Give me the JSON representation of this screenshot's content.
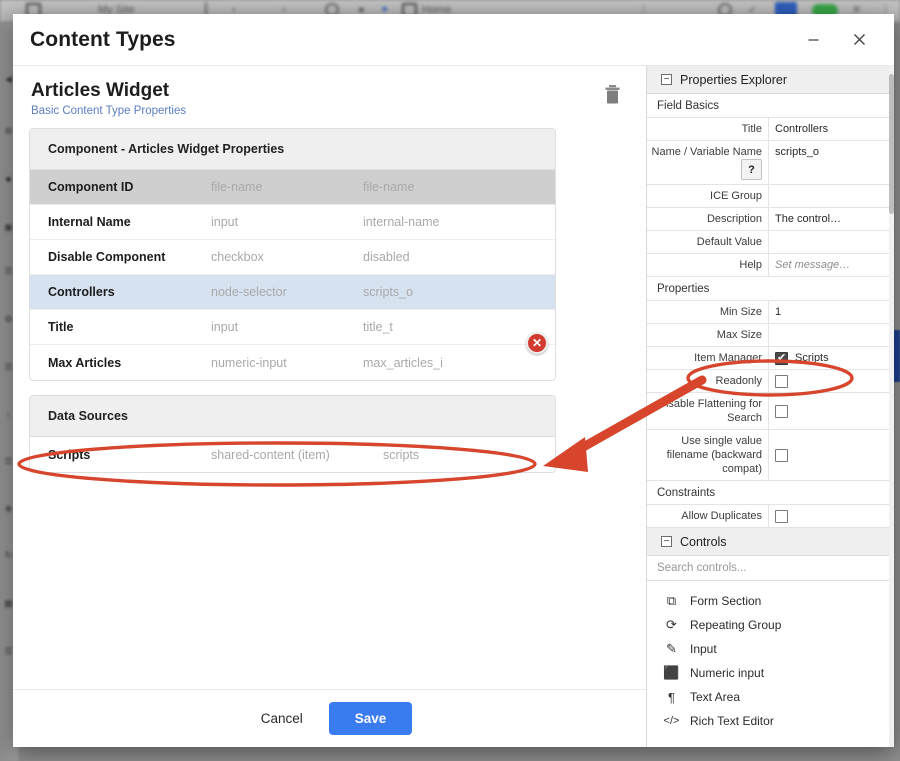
{
  "window": {
    "title": "Content Types",
    "minimize_label": "–",
    "close_label": "✕"
  },
  "content_type": {
    "name": "Articles Widget",
    "subtitle": "Basic Content Type Properties",
    "delete_icon": "trash-icon"
  },
  "properties_card": {
    "header": "Component - Articles Widget Properties",
    "rows": [
      {
        "name": "Component ID",
        "type": "file-name",
        "variable": "file-name",
        "state": "shaded"
      },
      {
        "name": "Internal Name",
        "type": "input",
        "variable": "internal-name",
        "state": "normal"
      },
      {
        "name": "Disable Component",
        "type": "checkbox",
        "variable": "disabled",
        "state": "normal"
      },
      {
        "name": "Controllers",
        "type": "node-selector",
        "variable": "scripts_o",
        "state": "selected"
      },
      {
        "name": "Title",
        "type": "input",
        "variable": "title_t",
        "state": "normal"
      },
      {
        "name": "Max Articles",
        "type": "numeric-input",
        "variable": "max_articles_i",
        "state": "normal"
      }
    ],
    "delete_field_label": "✕"
  },
  "data_sources_card": {
    "header": "Data Sources",
    "rows": [
      {
        "name": "Scripts",
        "type": "shared-content (item)",
        "variable": "scripts"
      }
    ]
  },
  "footer": {
    "cancel_label": "Cancel",
    "save_label": "Save"
  },
  "properties_explorer": {
    "title": "Properties Explorer",
    "collapse_glyph": "−",
    "field_basics": {
      "label": "Field Basics",
      "rows": [
        {
          "label": "Title",
          "value": "Controllers",
          "kind": "text"
        },
        {
          "label": "Name / Variable Name",
          "value": "scripts_o",
          "kind": "text-help",
          "help_glyph": "?"
        },
        {
          "label": "ICE Group",
          "value": "",
          "kind": "text"
        },
        {
          "label": "Description",
          "value": "The control…",
          "kind": "text"
        },
        {
          "label": "Default Value",
          "value": "",
          "kind": "text"
        },
        {
          "label": "Help",
          "value": "Set message…",
          "kind": "placeholder"
        }
      ]
    },
    "properties": {
      "label": "Properties",
      "rows": [
        {
          "label": "Min Size",
          "value": "1",
          "kind": "text"
        },
        {
          "label": "Max Size",
          "value": "",
          "kind": "text"
        },
        {
          "label": "Item Manager",
          "value": "Scripts",
          "kind": "checkbox",
          "checked": true
        },
        {
          "label": "Readonly",
          "value": "",
          "kind": "checkbox",
          "checked": false
        },
        {
          "label": "Disable Flattening for Search",
          "value": "",
          "kind": "checkbox",
          "checked": false
        },
        {
          "label": "Use single value filename (backward compat)",
          "value": "",
          "kind": "checkbox",
          "checked": false
        }
      ]
    },
    "constraints": {
      "label": "Constraints",
      "rows": [
        {
          "label": "Allow Duplicates",
          "value": "",
          "kind": "checkbox",
          "checked": false
        }
      ]
    },
    "controls": {
      "title": "Controls",
      "collapse_glyph": "−",
      "search_placeholder": "Search controls...",
      "items": [
        {
          "label": "Form Section",
          "icon": "form-section-icon",
          "glyph": "⧉"
        },
        {
          "label": "Repeating Group",
          "icon": "repeating-group-icon",
          "glyph": "⟳"
        },
        {
          "label": "Input",
          "icon": "input-icon",
          "glyph": "✎"
        },
        {
          "label": "Numeric input",
          "icon": "numeric-input-icon",
          "glyph": "⬛"
        },
        {
          "label": "Text Area",
          "icon": "text-area-icon",
          "glyph": "¶"
        },
        {
          "label": "Rich Text Editor",
          "icon": "rich-text-editor-icon",
          "glyph": "</>"
        }
      ]
    }
  },
  "annotations": {
    "color": "#d6452c",
    "highlight_item_manager": "Item Manager",
    "highlight_scripts_row": "Scripts",
    "arrow": "points from Item Manager property to the Scripts data source row"
  },
  "background": {
    "tab_label": "My Site",
    "nav_label": "Home"
  },
  "colors": {
    "accent_blue": "#3a7bf0",
    "link_blue": "#5b7dc2",
    "selected_row": "#d6e2f0",
    "shaded_row": "#cfcfcf",
    "annotation_red": "#d6452c",
    "delete_red": "#d13a2e"
  }
}
